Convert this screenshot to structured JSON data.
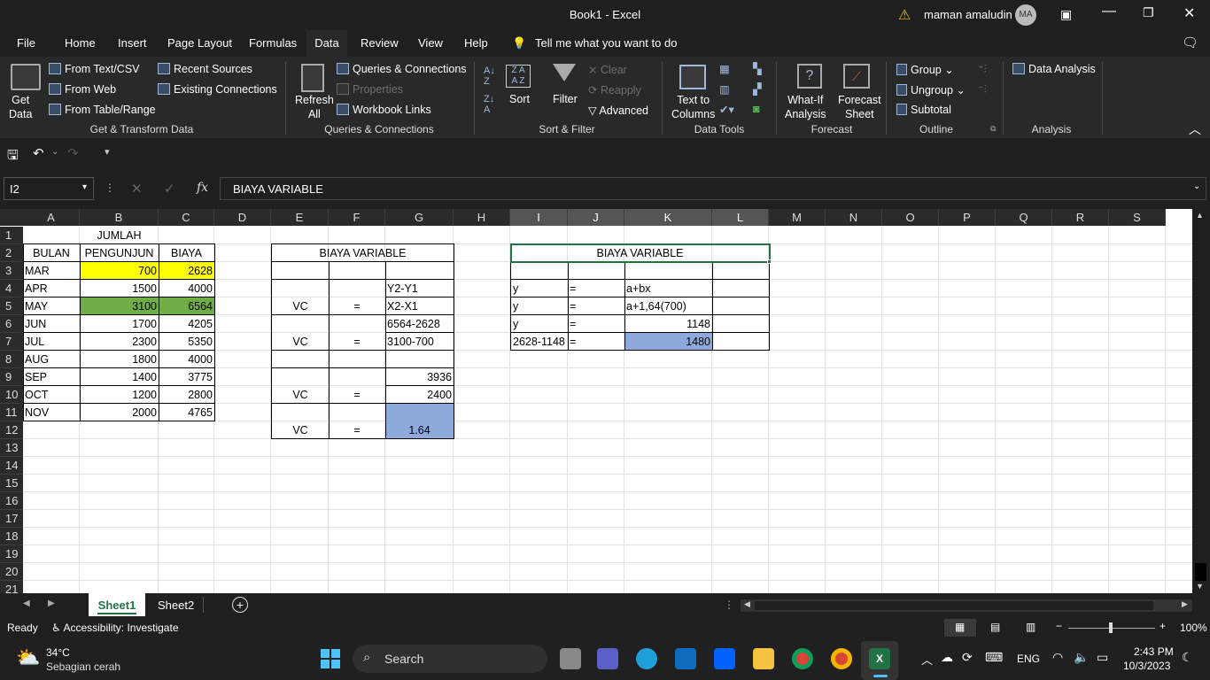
{
  "title": {
    "text": "Book1  -  Excel",
    "user": "maman amaludin",
    "initials": "MA"
  },
  "menu": [
    "File",
    "Home",
    "Insert",
    "Page Layout",
    "Formulas",
    "Data",
    "Review",
    "View",
    "Help"
  ],
  "menu_active": "Data",
  "tell_me": "Tell me what you want to do",
  "ribbon": {
    "get_data": "Get\nData",
    "from_text": "From Text/CSV",
    "from_web": "From Web",
    "from_table": "From Table/Range",
    "recent_sources": "Recent Sources",
    "existing_connections": "Existing Connections",
    "refresh_all": "Refresh\nAll",
    "queries_connections": "Queries & Connections",
    "properties": "Properties",
    "workbook_links": "Workbook Links",
    "sort": "Sort",
    "filter": "Filter",
    "clear": "Clear",
    "reapply": "Reapply",
    "advanced": "Advanced",
    "text_to_columns": "Text to\nColumns",
    "what_if": "What-If\nAnalysis",
    "forecast_sheet": "Forecast\nSheet",
    "group": "Group",
    "ungroup": "Ungroup",
    "subtotal": "Subtotal",
    "data_analysis": "Data Analysis",
    "groups": [
      "Get & Transform Data",
      "Queries & Connections",
      "Sort & Filter",
      "Data Tools",
      "Forecast",
      "Outline",
      "Analysis"
    ]
  },
  "namebox": "I2",
  "formula": "BIAYA VARIABLE",
  "columns": [
    "A",
    "B",
    "C",
    "D",
    "E",
    "F",
    "G",
    "H",
    "I",
    "J",
    "K",
    "L",
    "M",
    "N",
    "O",
    "P",
    "Q",
    "R",
    "S"
  ],
  "rows": [
    "1",
    "2",
    "3",
    "4",
    "5",
    "6",
    "7",
    "8",
    "9",
    "10",
    "11",
    "12",
    "13",
    "14",
    "15",
    "16",
    "17",
    "18",
    "19",
    "20",
    "21"
  ],
  "table1": {
    "header_jumlah": "JUMLAH",
    "header_bulan": "BULAN",
    "header_pengunjun": "PENGUNJUN",
    "header_biaya": "BIAYA",
    "rows": [
      [
        "MAR",
        "700",
        "2628"
      ],
      [
        "APR",
        "1500",
        "4000"
      ],
      [
        "MAY",
        "3100",
        "6564"
      ],
      [
        "JUN",
        "1700",
        "4205"
      ],
      [
        "JUL",
        "2300",
        "5350"
      ],
      [
        "AUG",
        "1800",
        "4000"
      ],
      [
        "SEP",
        "1400",
        "3775"
      ],
      [
        "OCT",
        "1200",
        "2800"
      ],
      [
        "NOV",
        "2000",
        "4765"
      ]
    ]
  },
  "table2": {
    "title": "BIAYA VARIABLE",
    "vc": "VC",
    "eq": "=",
    "g4": "Y2-Y1",
    "g5": "X2-X1",
    "g6": "6564-2628",
    "g7": "3100-700",
    "g9": "3936",
    "g10": "2400",
    "g12": "1.64"
  },
  "table3": {
    "title": "BIAYA VARIABLE",
    "i4": "y",
    "j4": "=",
    "k4": "a+bx",
    "i5": "y",
    "j5": "=",
    "k5": "a+1,64(700)",
    "i6": "y",
    "j6": "=",
    "k6": "1148",
    "i7": "2628-1148",
    "j7": "=",
    "k7": "1480"
  },
  "sheets": [
    "Sheet1",
    "Sheet2"
  ],
  "active_sheet": "Sheet1",
  "status": {
    "ready": "Ready",
    "accessibility": "Accessibility: Investigate",
    "zoom": "100%"
  },
  "taskbar": {
    "temp": "34°C",
    "weather": "Sebagian cerah",
    "search": "Search",
    "lang": "ENG",
    "time": "2:43 PM",
    "date": "10/3/2023"
  },
  "colors": {
    "yellow": "#ffff00",
    "green": "#70ad47",
    "blue": "#8ea9db",
    "excel": "#217346"
  }
}
